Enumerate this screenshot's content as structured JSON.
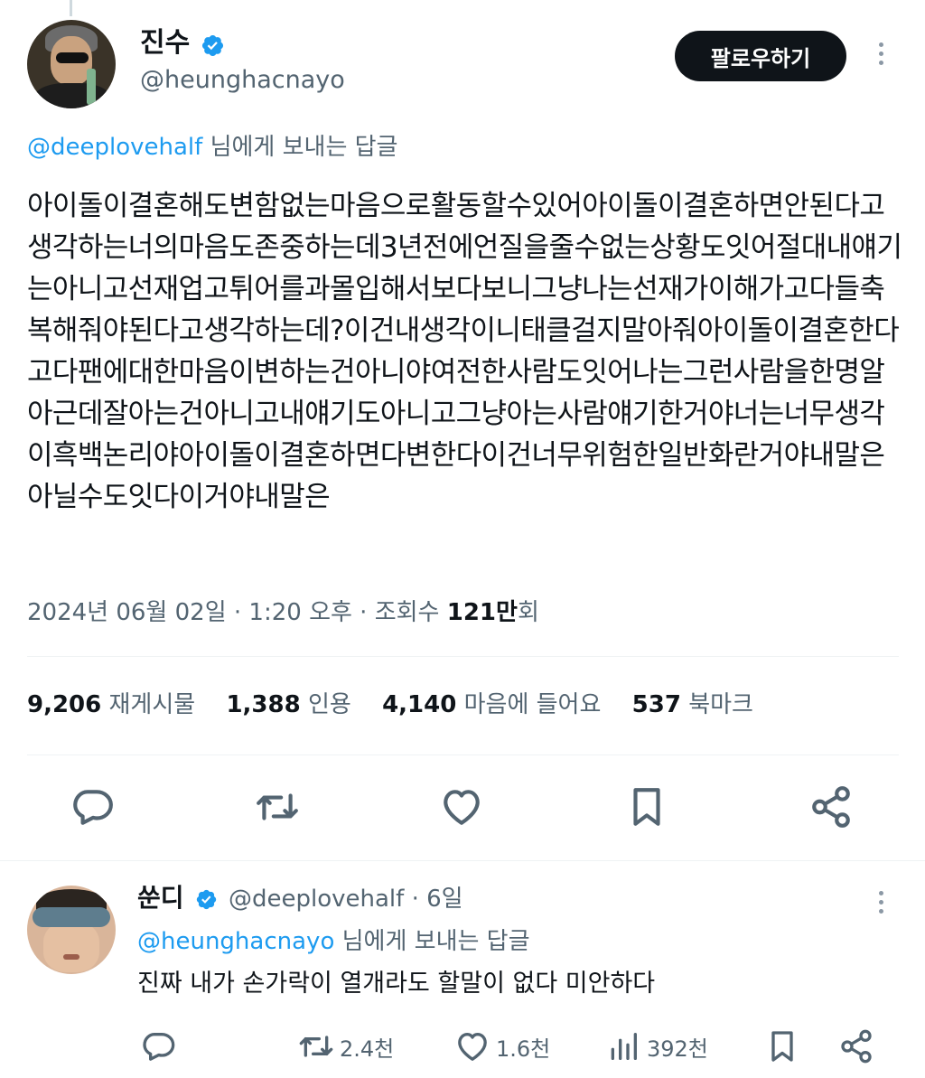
{
  "tweet": {
    "author": {
      "display_name": "진수",
      "handle": "@heunghacnayo",
      "verified": true
    },
    "follow_button_label": "팔로우하기",
    "reply_to": {
      "handle": "@deeplovehalf",
      "suffix": " 님에게 보내는 답글"
    },
    "text": "아이돌이결혼해도변함없는마음으로활동할수있어아이돌이결혼하면안된다고생각하는너의마음도존중하는데3년전에언질을줄수없는상황도잇어절대내얘기는아니고선재업고튀어를과몰입해서보다보니그냥나는선재가이해가고다들축복해줘야된다고생각하는데?이건내생각이니태클걸지말아줘아이돌이결혼한다고다팬에대한마음이변하는건아니야여전한사람도잇어나는그런사람을한명알아근데잘아는건아니고내얘기도아니고그냥아는사람얘기한거야너는너무생각이흑백논리야아이돌이결혼하면다변한다이건너무위험한일반화란거야내말은아닐수도잇다이거야내말은",
    "meta": {
      "date_time": "2024년 06월 02일 · 1:20 오후 · 조회수 ",
      "views_value": "121만",
      "views_suffix": "회"
    },
    "stats": {
      "retweets_value": "9,206",
      "retweets_label": "재게시물",
      "quotes_value": "1,388",
      "quotes_label": "인용",
      "likes_value": "4,140",
      "likes_label": "마음에 들어요",
      "bookmarks_value": "537",
      "bookmarks_label": "북마크"
    },
    "actions": [
      "reply-icon",
      "retweet-icon",
      "like-icon",
      "bookmark-icon",
      "share-icon"
    ]
  },
  "reply": {
    "author": {
      "display_name": "쑨디",
      "handle": "@deeplovehalf",
      "verified": true
    },
    "time": " · 6일",
    "reply_to": {
      "handle": "@heunghacnayo",
      "suffix": " 님에게 보내는 답글"
    },
    "text": "진짜 내가 손가락이 열개라도 할말이 없다 미안하다",
    "counts": {
      "retweets": "2.4천",
      "likes": "1.6천",
      "views": "392천"
    }
  },
  "colors": {
    "accent": "#1d9bf0",
    "text_primary": "#0f1419",
    "text_secondary": "#536471",
    "divider": "#eff3f4",
    "button_bg": "#0f1419"
  }
}
